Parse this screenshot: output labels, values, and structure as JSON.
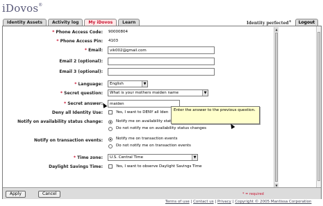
{
  "app": {
    "logo": "iDovos",
    "logo_mark": "®",
    "tagline": "Identity perfected",
    "tagline_mark": "®"
  },
  "tabs": [
    {
      "label": "Identity Assets",
      "active": false
    },
    {
      "label": "Activity log",
      "active": false
    },
    {
      "label": "My iDovos",
      "active": true
    },
    {
      "label": "Learn",
      "active": false
    }
  ],
  "logout_label": "Logout",
  "form": {
    "phone_access_code": {
      "label": "Phone Access Code:",
      "value": "90000804"
    },
    "phone_access_pin": {
      "label": "Phone Access Pin:",
      "value": "4103"
    },
    "email": {
      "label": "Email:",
      "value": "vik002@gmail.com"
    },
    "email2": {
      "label": "Email 2 (optional):",
      "value": ""
    },
    "email3": {
      "label": "Email 3 (optional):",
      "value": ""
    },
    "language": {
      "label": "Language:",
      "value": "English"
    },
    "secret_question": {
      "label": "Secret question:",
      "value": "What is your mothers maiden name"
    },
    "secret_answer": {
      "label": "Secret answer:",
      "value": "maiden"
    },
    "deny_all": {
      "label": "Deny all Identity Use:",
      "option": "Yes, I want to DENY all Iden"
    },
    "notify_availability": {
      "label": "Notify on availability status change:",
      "options": [
        "Notify me on availability stat",
        "Do not notify me on availability status changes"
      ]
    },
    "notify_transaction": {
      "label": "Notify on transaction events:",
      "options": [
        "Notify me on transaction events",
        "Do not notify me on transaction events"
      ]
    },
    "time_zone": {
      "label": "Time zone:",
      "value": "U.S. Central Time"
    },
    "dst": {
      "label": "Daylight Savings Time:",
      "option": "Yes, I want to observe Daylight Savings Time"
    }
  },
  "required_marker": "*",
  "tooltip": "Enter the answer to the previous question.",
  "footer": {
    "apply": "Apply",
    "cancel": "Cancel",
    "required_note": "* = required"
  },
  "links": {
    "terms": "Terms of use",
    "contact": "Contact us",
    "privacy": "Privacy",
    "copyright": "Copyright © 2005 Mantissa Corporation"
  }
}
